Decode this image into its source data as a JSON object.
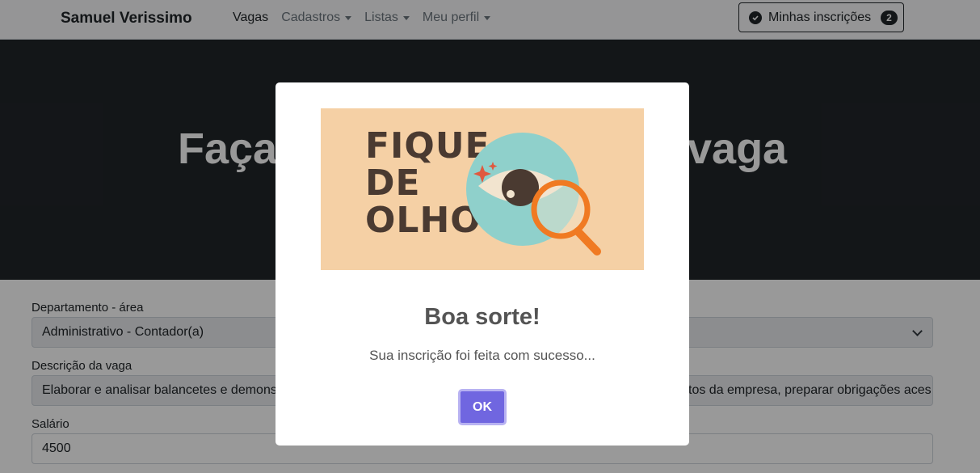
{
  "navbar": {
    "brand": "Samuel Verissimo",
    "items": [
      {
        "label": "Vagas",
        "dropdown": false
      },
      {
        "label": "Cadastros",
        "dropdown": true
      },
      {
        "label": "Listas",
        "dropdown": true
      },
      {
        "label": "Meu perfil",
        "dropdown": true
      }
    ],
    "inscricoes": {
      "label": "Minhas inscrições",
      "count": "2"
    }
  },
  "hero": {
    "title_left": "Faça",
    "title_right": "vaga"
  },
  "form": {
    "departamento": {
      "label": "Departamento - área",
      "value": "Administrativo - Contador(a)"
    },
    "descricao": {
      "label": "Descrição da vaga",
      "value_left": "Elaborar e analisar balancetes e demonst",
      "value_right": "tos da empresa, preparar obrigações aces"
    },
    "salario": {
      "label": "Salário",
      "value": "4500"
    }
  },
  "modal": {
    "banner_text": "FIQUE DE OLHO",
    "banner_lines": [
      "FIQUE",
      "DE",
      "OLHO"
    ],
    "title": "Boa sorte!",
    "text": "Sua inscrição foi feita com sucesso...",
    "ok_label": "OK"
  },
  "colors": {
    "brand_dark": "#212529",
    "confirm_button": "#7066e0",
    "banner_bg": "#f5d0a5",
    "eye_circle": "#8fd0cb",
    "magnifier": "#f07a22"
  }
}
